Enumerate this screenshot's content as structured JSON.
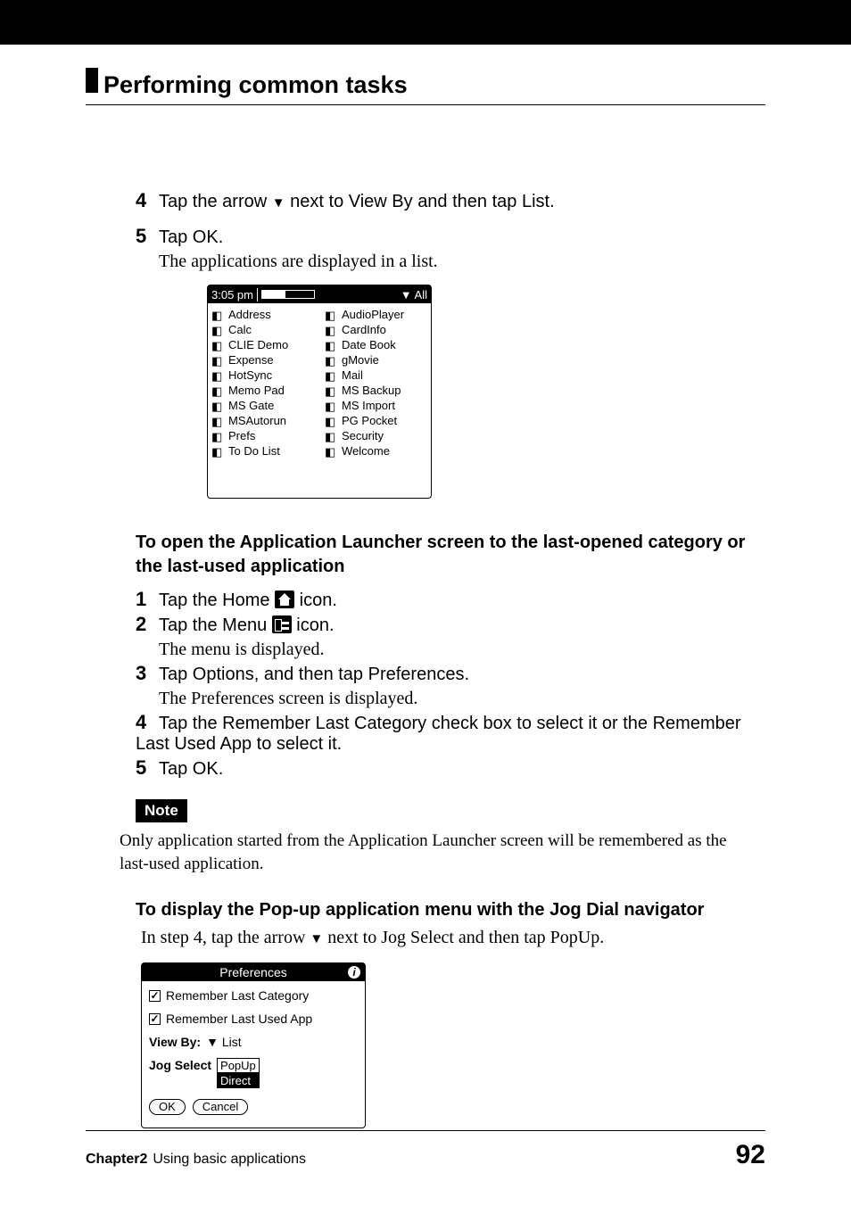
{
  "header": {
    "title": "Performing common tasks"
  },
  "step4": {
    "num": "4",
    "text_before": "Tap the arrow ",
    "text_after": " next to View By and then tap List."
  },
  "step5": {
    "num": "5",
    "text": "Tap OK.",
    "sub": "The applications are displayed in a list."
  },
  "launcher_screenshot": {
    "time": "3:05 pm",
    "category_label": "All",
    "left_col": [
      "Address",
      "Calc",
      "CLIE Demo",
      "Expense",
      "HotSync",
      "Memo Pad",
      "MS Gate",
      "MSAutorun",
      "Prefs",
      "To Do List"
    ],
    "right_col": [
      "AudioPlayer",
      "CardInfo",
      "Date Book",
      "gMovie",
      "Mail",
      "MS Backup",
      "MS Import",
      "PG Pocket",
      "Security",
      "Welcome"
    ]
  },
  "subheading1": "To open the Application Launcher screen to the last-opened category or the last-used application",
  "procedure": {
    "step1": {
      "num": "1",
      "before": "Tap the Home ",
      "after": " icon."
    },
    "step2": {
      "num": "2",
      "before": "Tap the Menu ",
      "after": " icon.",
      "sub": "The menu is displayed."
    },
    "step3": {
      "num": "3",
      "text": "Tap Options, and then tap Preferences.",
      "sub": "The Preferences screen is displayed."
    },
    "step4": {
      "num": "4",
      "text": "Tap the Remember Last Category check box to select it or the Remember Last Used App to select it."
    },
    "step5": {
      "num": "5",
      "text": "Tap OK."
    }
  },
  "note": {
    "label": "Note",
    "text": "Only application started from the Application Launcher screen will be remembered as the last-used application."
  },
  "subheading2": "To display the Pop-up application menu with the Jog Dial navigator",
  "body_line": {
    "before": " In step 4, tap the arrow ",
    "after": " next to Jog Select and then tap PopUp."
  },
  "prefs_screenshot": {
    "title": "Preferences",
    "check1": "Remember Last Category",
    "check2": "Remember Last Used App",
    "viewby_label": "View By:",
    "viewby_value": "List",
    "jogselect_label": "Jog Select",
    "jog_options": [
      "PopUp",
      "Direct"
    ],
    "ok": "OK",
    "cancel": "Cancel"
  },
  "footer": {
    "chapter_bold": "Chapter2",
    "chapter_rest": "Using basic applications",
    "page": "92"
  }
}
